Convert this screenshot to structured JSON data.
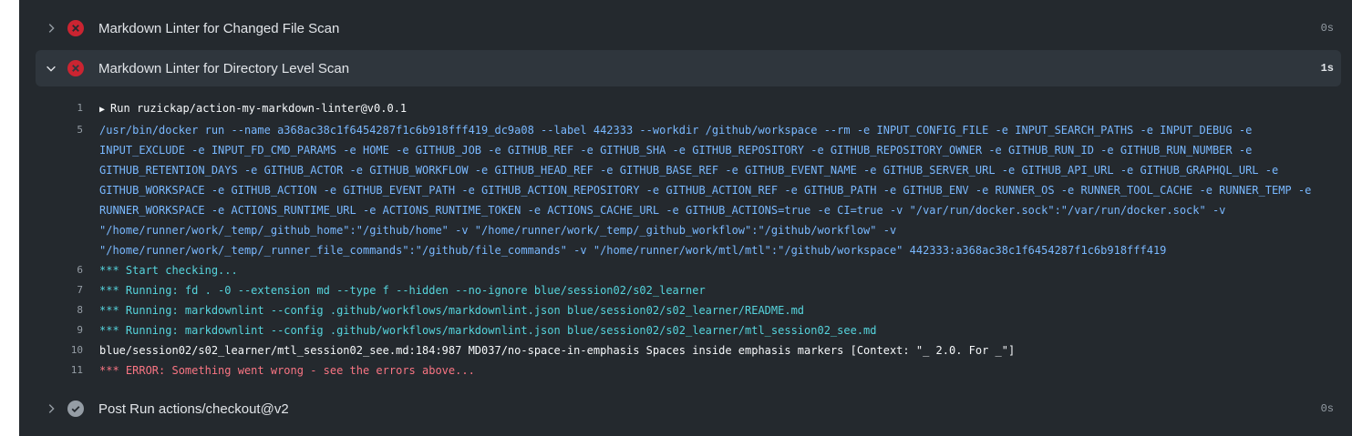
{
  "steps": [
    {
      "title": "Markdown Linter for Changed File Scan",
      "duration": "0s",
      "status": "failed",
      "expanded": false
    },
    {
      "title": "Markdown Linter for Directory Level Scan",
      "duration": "1s",
      "status": "failed",
      "expanded": true
    },
    {
      "title": "Post Run actions/checkout@v2",
      "duration": "0s",
      "status": "success",
      "expanded": false
    }
  ],
  "log": [
    {
      "num": "1",
      "color": "white",
      "text": "Run ruzickap/action-my-markdown-linter@v0.0.1",
      "collapsed_group": true
    },
    {
      "num": "5",
      "color": "blue",
      "text": "/usr/bin/docker run --name a368ac38c1f6454287f1c6b918fff419_dc9a08 --label 442333 --workdir /github/workspace --rm -e INPUT_CONFIG_FILE -e INPUT_SEARCH_PATHS -e INPUT_DEBUG -e INPUT_EXCLUDE -e INPUT_FD_CMD_PARAMS -e HOME -e GITHUB_JOB -e GITHUB_REF -e GITHUB_SHA -e GITHUB_REPOSITORY -e GITHUB_REPOSITORY_OWNER -e GITHUB_RUN_ID -e GITHUB_RUN_NUMBER -e GITHUB_RETENTION_DAYS -e GITHUB_ACTOR -e GITHUB_WORKFLOW -e GITHUB_HEAD_REF -e GITHUB_BASE_REF -e GITHUB_EVENT_NAME -e GITHUB_SERVER_URL -e GITHUB_API_URL -e GITHUB_GRAPHQL_URL -e GITHUB_WORKSPACE -e GITHUB_ACTION -e GITHUB_EVENT_PATH -e GITHUB_ACTION_REPOSITORY -e GITHUB_ACTION_REF -e GITHUB_PATH -e GITHUB_ENV -e RUNNER_OS -e RUNNER_TOOL_CACHE -e RUNNER_TEMP -e RUNNER_WORKSPACE -e ACTIONS_RUNTIME_URL -e ACTIONS_RUNTIME_TOKEN -e ACTIONS_CACHE_URL -e GITHUB_ACTIONS=true -e CI=true -v \"/var/run/docker.sock\":\"/var/run/docker.sock\" -v \"/home/runner/work/_temp/_github_home\":\"/github/home\" -v \"/home/runner/work/_temp/_github_workflow\":\"/github/workflow\" -v \"/home/runner/work/_temp/_runner_file_commands\":\"/github/file_commands\" -v \"/home/runner/work/mtl/mtl\":\"/github/workspace\" 442333:a368ac38c1f6454287f1c6b918fff419"
    },
    {
      "num": "6",
      "color": "cyan",
      "text": "*** Start checking..."
    },
    {
      "num": "7",
      "color": "cyan",
      "text": "*** Running: fd . -0 --extension md --type f --hidden --no-ignore blue/session02/s02_learner"
    },
    {
      "num": "8",
      "color": "cyan",
      "text": "*** Running: markdownlint --config .github/workflows/markdownlint.json blue/session02/s02_learner/README.md"
    },
    {
      "num": "9",
      "color": "cyan",
      "text": "*** Running: markdownlint --config .github/workflows/markdownlint.json blue/session02/s02_learner/mtl_session02_see.md"
    },
    {
      "num": "10",
      "color": "white",
      "text": "blue/session02/s02_learner/mtl_session02_see.md:184:987 MD037/no-space-in-emphasis Spaces inside emphasis markers [Context: \"_ 2.0. For _\"]"
    },
    {
      "num": "11",
      "color": "red",
      "text": "*** ERROR: Something went wrong - see the errors above..."
    }
  ],
  "colors": {
    "panel_bg": "#24292e",
    "active_step_bg": "#2f363d",
    "failed": "#cb2431",
    "success": "#959da5",
    "log_blue": "#79b8ff",
    "log_cyan": "#56d4dd",
    "log_red": "#f97583"
  },
  "icons": {
    "collapsed": "chevron-right-icon",
    "expanded": "chevron-down-icon",
    "failed": "x-circle-icon",
    "success": "check-circle-icon",
    "group": "triangle-right-icon"
  }
}
